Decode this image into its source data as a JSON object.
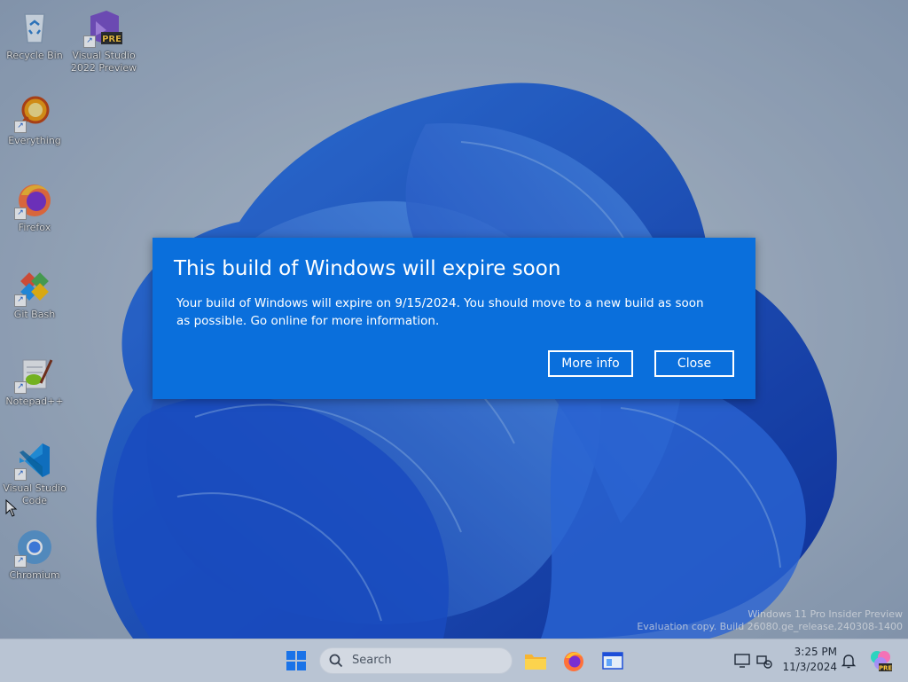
{
  "desktop_icons": [
    {
      "label": "Recycle Bin",
      "icon": "recycle-bin-icon"
    },
    {
      "label": "Visual Studio 2022 Preview",
      "icon": "visual-studio-preview-icon",
      "badge": "PRE"
    },
    {
      "label": "Everything",
      "icon": "everything-search-icon"
    },
    {
      "label": "Firefox",
      "icon": "firefox-icon"
    },
    {
      "label": "Git Bash",
      "icon": "git-bash-icon"
    },
    {
      "label": "Notepad++",
      "icon": "notepad-plus-plus-icon"
    },
    {
      "label": "Visual Studio Code",
      "icon": "vscode-icon"
    },
    {
      "label": "Chromium",
      "icon": "chromium-icon"
    }
  ],
  "dialog": {
    "title": "This build of Windows will expire soon",
    "body": "Your build of Windows will expire on 9/15/2024. You should move to a new build as soon as possible. Go online for more information.",
    "more_info_label": "More info",
    "close_label": "Close",
    "background_color": "#0a6fdc"
  },
  "watermark": {
    "line1": "Windows 11 Pro Insider Preview",
    "line2": "Evaluation copy. Build 26080.ge_release.240308-1400"
  },
  "taskbar": {
    "search_placeholder": "Search",
    "pinned": [
      "start-icon",
      "file-explorer-icon",
      "firefox-icon",
      "app-window-icon"
    ],
    "tray_icons": [
      "display-icon",
      "network-icon",
      "notification-bell-icon",
      "copilot-pre-icon"
    ],
    "time": "3:25 PM",
    "date": "11/3/2024"
  },
  "colors": {
    "accent_blue": "#0a6fdc",
    "taskbar": "#b9c4d3"
  }
}
